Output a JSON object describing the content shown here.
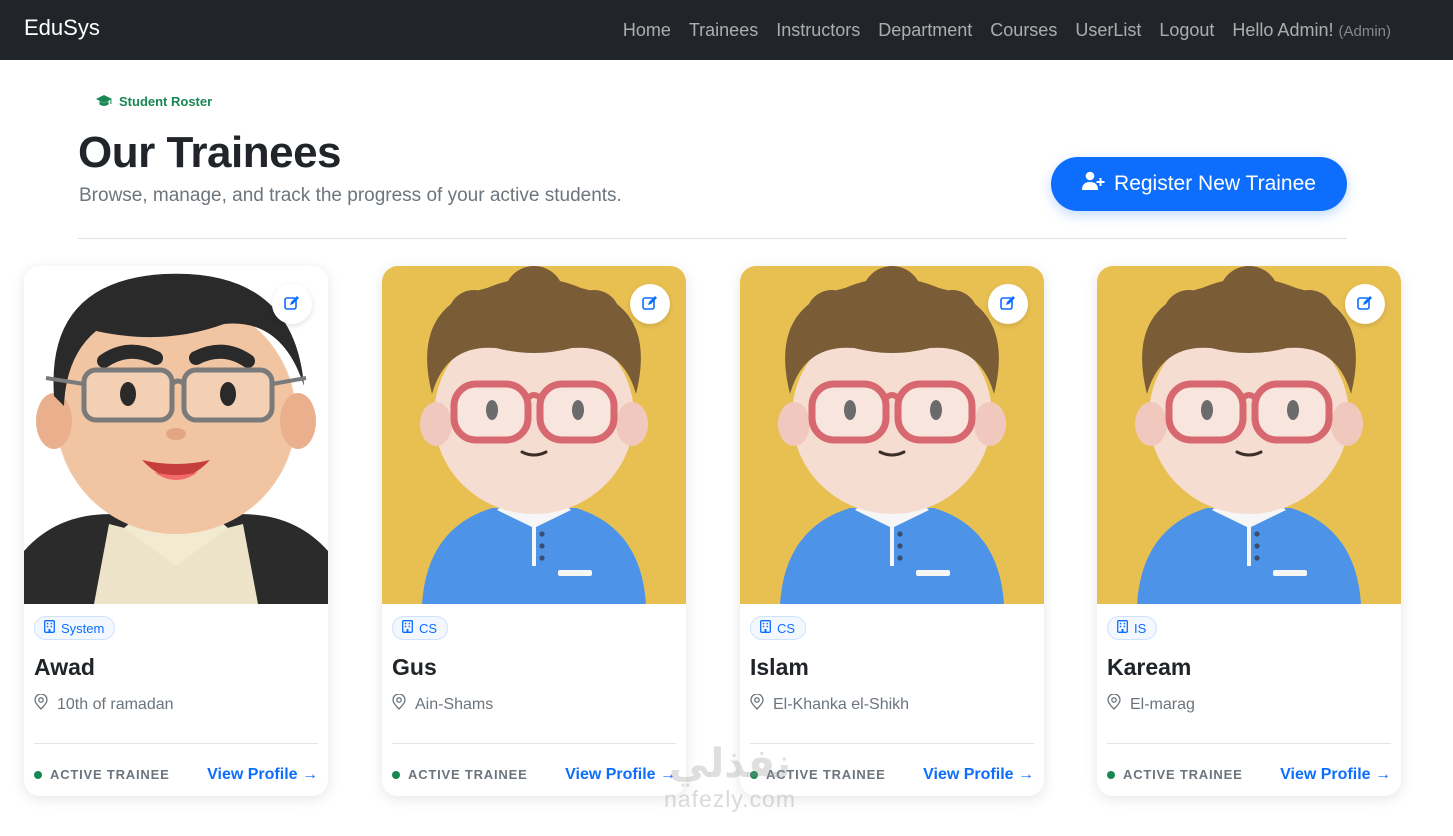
{
  "navbar": {
    "brand": "EduSys",
    "links": [
      "Home",
      "Trainees",
      "Instructors",
      "Department",
      "Courses",
      "UserList"
    ],
    "logout": "Logout",
    "greeting": "Hello Admin!",
    "role": "(Admin)"
  },
  "header": {
    "eyebrow": "Student Roster",
    "title": "Our Trainees",
    "subtitle": "Browse, manage, and track the progress of your active students.",
    "register_label": "Register New Trainee"
  },
  "trainees": [
    {
      "department": "System",
      "name": "Awad",
      "address": "10th of ramadan",
      "status": "ACTIVE TRAINEE",
      "link": "View Profile →",
      "avatar": "avatar-glasses-dark-hair"
    },
    {
      "department": "CS",
      "name": "Gus",
      "address": "Ain-Shams",
      "status": "ACTIVE TRAINEE",
      "link": "View Profile →",
      "avatar": "avatar-red-glasses-yellow-bg"
    },
    {
      "department": "CS",
      "name": "Islam",
      "address": "El-Khanka el-Shikh",
      "status": "ACTIVE TRAINEE",
      "link": "View Profile →",
      "avatar": "avatar-red-glasses-yellow-bg"
    },
    {
      "department": "IS",
      "name": "Kaream",
      "address": "El-marag",
      "status": "ACTIVE TRAINEE",
      "link": "View Profile →",
      "avatar": "avatar-red-glasses-yellow-bg"
    }
  ],
  "watermark": {
    "arabic": "نفذلي",
    "latin": "nafezly.com"
  },
  "colors": {
    "navbar": "#212529",
    "primary": "#0d6efd",
    "success": "#198754",
    "avatar_bg": "#e8c052",
    "shirt": "#4d94e8"
  },
  "icons": {
    "eyebrow": "graduation-cap-icon",
    "register": "user-plus-icon",
    "edit": "edit-square-icon",
    "department": "building-icon",
    "address": "map-pin-icon"
  }
}
